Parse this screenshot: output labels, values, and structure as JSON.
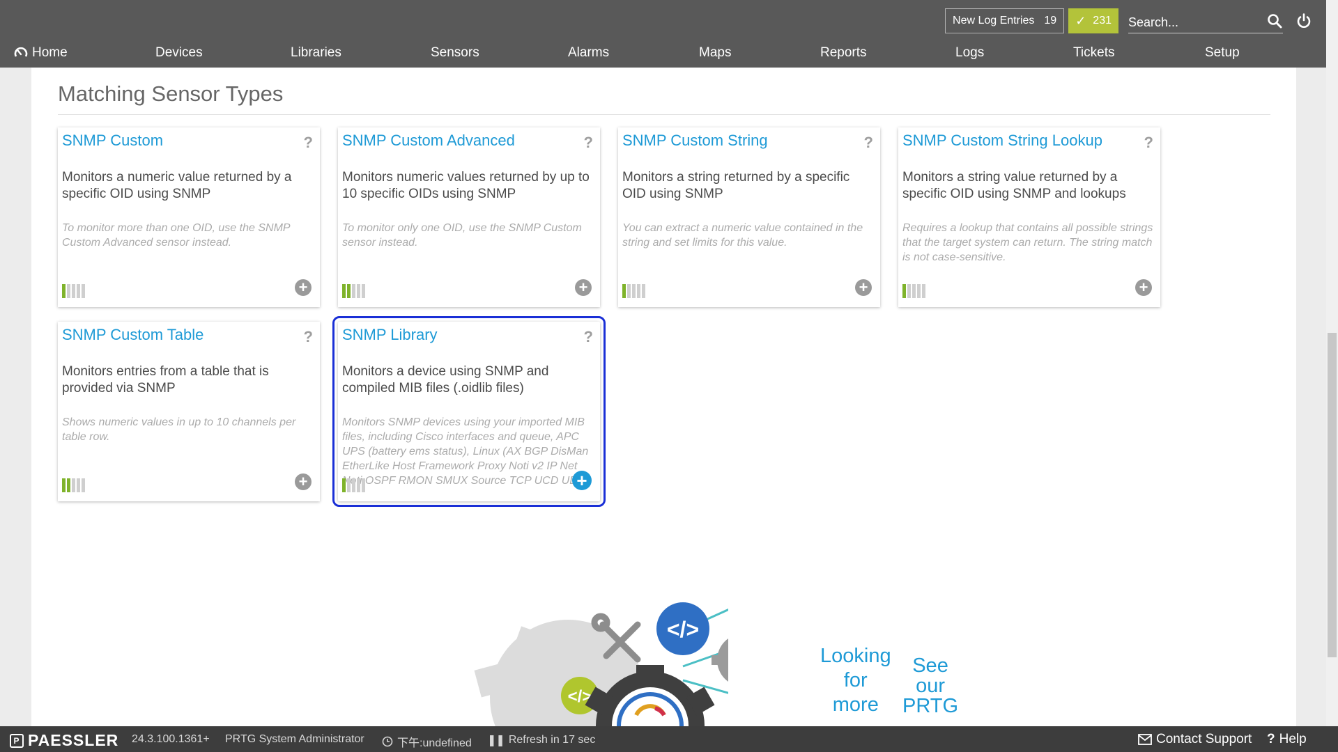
{
  "topbar": {
    "log_label": "New Log Entries",
    "log_count": "19",
    "ok_count": "231",
    "search_placeholder": "Search...",
    "colors": {
      "bar": "#595959",
      "ok_badge": "#b3c33a"
    }
  },
  "nav": {
    "items": [
      {
        "label": "Home",
        "icon": "home-gauge-icon"
      },
      {
        "label": "Devices"
      },
      {
        "label": "Libraries"
      },
      {
        "label": "Sensors"
      },
      {
        "label": "Alarms"
      },
      {
        "label": "Maps"
      },
      {
        "label": "Reports"
      },
      {
        "label": "Logs"
      },
      {
        "label": "Tickets"
      },
      {
        "label": "Setup"
      }
    ]
  },
  "main": {
    "section_title": "Matching Sensor Types",
    "cards": [
      {
        "title": "SNMP Custom",
        "description": "Monitors a numeric value returned by a specific OID using SNMP",
        "note": "To monitor more than one OID, use the SNMP Custom Advanced sensor instead.",
        "performance_level": 1,
        "performance_max": 5,
        "selected": false
      },
      {
        "title": "SNMP Custom Advanced",
        "description": "Monitors numeric values returned by up to 10 specific OIDs using SNMP",
        "note": "To monitor only one OID, use the SNMP Custom sensor instead.",
        "performance_level": 2,
        "performance_max": 5,
        "selected": false
      },
      {
        "title": "SNMP Custom String",
        "description": "Monitors a string returned by a specific OID using SNMP",
        "note": "You can extract a numeric value contained in the string and set limits for this value.",
        "performance_level": 1,
        "performance_max": 5,
        "selected": false
      },
      {
        "title": "SNMP Custom String Lookup",
        "description": "Monitors a string value returned by a specific OID using SNMP and lookups",
        "note": "Requires a lookup that contains all possible strings that the target system can return. The string match is not case-sensitive.",
        "performance_level": 1,
        "performance_max": 5,
        "selected": false
      },
      {
        "title": "SNMP Custom Table",
        "description": "Monitors entries from a table that is provided via SNMP",
        "note": "Shows numeric values in up to 10 channels per table row.",
        "performance_level": 2,
        "performance_max": 5,
        "selected": false
      },
      {
        "title": "SNMP Library",
        "description": "Monitors a device using SNMP and compiled MIB files (.oidlib files)",
        "note": "Monitors SNMP devices using your imported MIB files, including Cisco interfaces and queue, APC UPS (battery ems status), Linux (AX BGP DisMan EtherLike Host Framework Proxy Noti v2 IP Net Noti OSPF RMON SMUX Source TCP UCD UDP).",
        "performance_level": 1,
        "performance_max": 5,
        "selected": true
      }
    ],
    "help_glyph": "?",
    "add_glyph": "+",
    "colors": {
      "link": "#1e9ad6",
      "perf_on": "#7fb32b",
      "selection": "#1a2fd6"
    }
  },
  "promo": {
    "text_1": [
      "Looking",
      "for",
      "more"
    ],
    "text_2": [
      "See",
      "our",
      "PRTG"
    ]
  },
  "footer": {
    "brand": "PAESSLER",
    "version": "24.3.100.1361+",
    "user": "PRTG System Administrator",
    "time": "下午:undefined",
    "refresh": "Refresh in 17 sec",
    "contact": "Contact Support",
    "help": "Help"
  }
}
